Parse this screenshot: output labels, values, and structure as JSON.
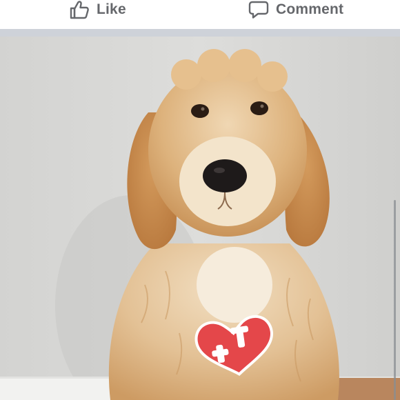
{
  "actions": {
    "like": {
      "label": "Like",
      "icon": "thumbs-up-icon"
    },
    "comment": {
      "label": "Comment",
      "icon": "comment-bubble-icon"
    }
  },
  "post": {
    "photo": "dog-photo",
    "tag_icon": "heart-tag-icon"
  },
  "colors": {
    "action_text": "#65676b",
    "divider": "#ced2d9",
    "tag_red": "#e4474a"
  }
}
